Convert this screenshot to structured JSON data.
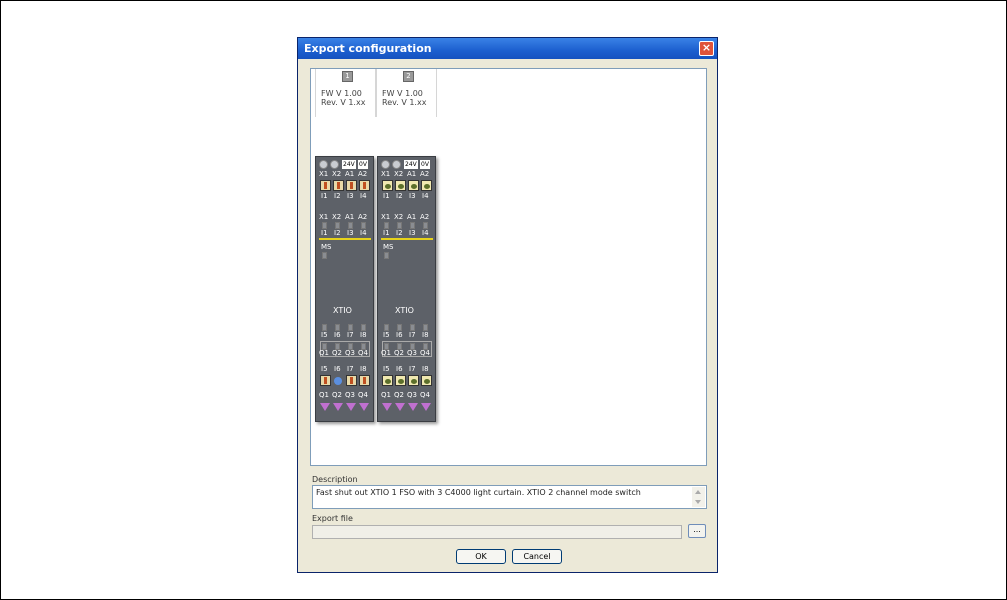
{
  "dialog": {
    "title": "Export configuration",
    "close": "×"
  },
  "modules": [
    {
      "number": "1",
      "fw": "FW V 1.00\nRev. V 1.xx",
      "top_labels": [
        "X1",
        "X2",
        "A1",
        "A2"
      ],
      "voltages": [
        "24V",
        "0V"
      ],
      "input_labels": [
        "I1",
        "I2",
        "I3",
        "I4"
      ],
      "led_labels_a": [
        "X1",
        "X2",
        "A1",
        "A2"
      ],
      "led_labels_b": [
        "I1",
        "I2",
        "I3",
        "I4"
      ],
      "ms": "MS",
      "name": "XTIO",
      "lower_in": [
        "I5",
        "I6",
        "I7",
        "I8"
      ],
      "lower_out": [
        "Q1",
        "Q2",
        "Q3",
        "Q4"
      ],
      "bottom_in": [
        "I5",
        "I6",
        "I7",
        "I8"
      ],
      "bottom_out": [
        "Q1",
        "Q2",
        "Q3",
        "Q4"
      ],
      "input_devices": [
        "device",
        "device",
        "device",
        "device"
      ],
      "lower_devices": [
        "switch",
        "lamp",
        "device",
        "device"
      ]
    },
    {
      "number": "2",
      "fw": "FW V 1.00\nRev. V 1.xx",
      "top_labels": [
        "X1",
        "X2",
        "A1",
        "A2"
      ],
      "voltages": [
        "24V",
        "0V"
      ],
      "input_labels": [
        "I1",
        "I2",
        "I3",
        "I4"
      ],
      "led_labels_a": [
        "X1",
        "X2",
        "A1",
        "A2"
      ],
      "led_labels_b": [
        "I1",
        "I2",
        "I3",
        "I4"
      ],
      "ms": "MS",
      "name": "XTIO",
      "lower_in": [
        "I5",
        "I6",
        "I7",
        "I8"
      ],
      "lower_out": [
        "Q1",
        "Q2",
        "Q3",
        "Q4"
      ],
      "bottom_in": [
        "I5",
        "I6",
        "I7",
        "I8"
      ],
      "bottom_out": [
        "Q1",
        "Q2",
        "Q3",
        "Q4"
      ],
      "input_devices": [
        "sensor",
        "sensor",
        "sensor",
        "sensor"
      ],
      "lower_devices": [
        "sensor",
        "sensor",
        "sensor",
        "sensor"
      ]
    }
  ],
  "form": {
    "description_label": "Description",
    "description_value": "Fast shut out XTIO 1 FSO with 3 C4000 light curtain. XTIO 2 channel mode switch",
    "export_file_label": "Export file",
    "export_file_value": "",
    "browse_label": "...",
    "ok_label": "OK",
    "cancel_label": "Cancel"
  },
  "colors": {
    "title_bar": "#1c5fcf",
    "module": "#5d6168",
    "status_line": "#e6d21a",
    "output_arrow": "#c070d0"
  }
}
